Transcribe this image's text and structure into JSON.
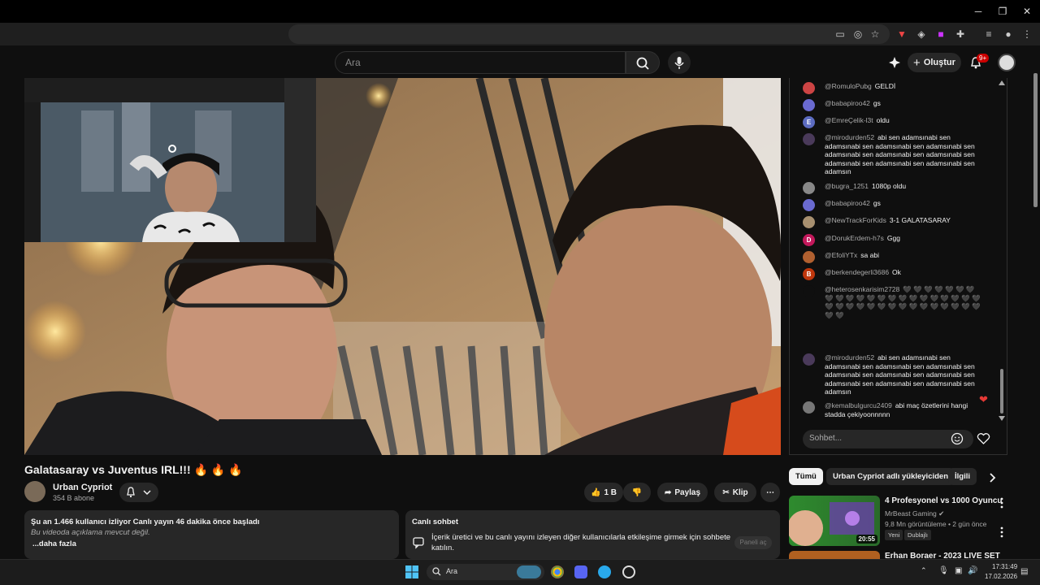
{
  "browser": {
    "window_controls": {
      "minimize": "─",
      "maximize": "❐",
      "close": "✕"
    }
  },
  "header": {
    "search_placeholder": "Ara",
    "create_label": "Oluştur",
    "notif_count": "9+"
  },
  "video": {
    "title": "Galatasaray vs Juventus IRL!!! 🔥 🔥 🔥",
    "channel": "Urban Cypriot",
    "subscribers": "354 B abone",
    "likes": "1 B",
    "share_label": "Paylaş",
    "clip_label": "Klip",
    "more_label": "⋯"
  },
  "description": {
    "line1": "Şu an 1.466 kullanıcı izliyor  Canlı yayın 46 dakika önce başladı",
    "line2": "Bu videoda açıklama mevcut değil.",
    "more": "...daha fazla"
  },
  "chat_panel": {
    "title": "Canlı sohbet",
    "desc": "İçerik üretici ve bu canlı yayını izleyen diğer kullanıcılarla etkileşime girmek için sohbete katılın.",
    "open_btn": "Paneli aç"
  },
  "live_chat": {
    "input_placeholder": "Sohbet...",
    "messages": [
      {
        "user": "@RomuloPubg",
        "text": "GELDİ",
        "avatar_color": "#c44",
        "avatar_letter": ""
      },
      {
        "user": "@babapiroo42",
        "text": "gs",
        "avatar_color": "#6a6ad0",
        "avatar_letter": ""
      },
      {
        "user": "@EmreÇelik-l3t",
        "text": "oldu",
        "avatar_color": "#5c6bc0",
        "avatar_letter": "E"
      },
      {
        "user": "@mirodurden52",
        "text": "abi sen adamsınabi sen adamsınabi sen adamsınabi sen adamsınabi sen adamsınabi sen adamsınabi sen adamsınabi sen adamsınabi sen adamsınabi sen adamsınabi sen adamsın",
        "avatar_color": "#4a3a5a",
        "avatar_letter": ""
      },
      {
        "user": "@bugra_1251",
        "text": "1080p oldu",
        "avatar_color": "#888",
        "avatar_letter": ""
      },
      {
        "user": "@babapiroo42",
        "text": "gs",
        "avatar_color": "#6a6ad0",
        "avatar_letter": ""
      },
      {
        "user": "@NewTrackForKids",
        "text": "3-1 GALATASARAY",
        "avatar_color": "#a89070",
        "avatar_letter": ""
      },
      {
        "user": "@DorukErdem-h7s",
        "text": "Ggg",
        "avatar_color": "#c2185b",
        "avatar_letter": "D"
      },
      {
        "user": "@EfoliYTx",
        "text": "sa abi",
        "avatar_color": "#b06030",
        "avatar_letter": ""
      },
      {
        "user": "@berkendegerli3686",
        "text": "Ok",
        "avatar_color": "#bf360c",
        "avatar_letter": "B"
      },
      {
        "user": "@heterosenkarisim2728",
        "text": "🖤 🖤 🖤 🖤 🖤 🖤 🖤 🖤 🖤 🖤 🖤 🖤 🖤 🖤 🖤 🖤 🖤 🖤 🖤 🖤 🖤 🖤 🖤 🖤 🖤 🖤 🖤 🖤 🖤 🖤 🖤 🖤 🖤 🖤 🖤 🖤 🖤 🖤 🖤",
        "avatar_color": "#0f0f0f",
        "avatar_letter": ""
      },
      {
        "user": "@mirodurden52",
        "text": "abi sen adamsınabi sen adamsınabi sen adamsınabi sen adamsınabi sen adamsınabi sen adamsınabi sen adamsınabi sen adamsınabi sen adamsınabi sen adamsınabi sen adamsın",
        "avatar_color": "#4a3a5a",
        "avatar_letter": ""
      },
      {
        "user": "@kemalbulgurcu2409",
        "text": "abi maç özetlerini hangi stadda çekiyoonnnnn",
        "avatar_color": "#777",
        "avatar_letter": ""
      }
    ]
  },
  "recommendations": {
    "chips": [
      "Tümü",
      "Urban Cypriot adlı yükleyiciden",
      "İlgili"
    ],
    "items": [
      {
        "title": "4 Profesyonel vs 1000 Oyuncu",
        "channel": "MrBeast Gaming",
        "meta": "9,8 Mn görüntüleme • 2 gün önce",
        "duration": "20:55",
        "tags": [
          "Yeni",
          "Dublajlı"
        ]
      },
      {
        "title": "Erhan Boraer - 2023 LIVE SET"
      }
    ]
  },
  "taskbar": {
    "search": "Ara",
    "time": "17:31:49",
    "date": "17.02.2026"
  }
}
